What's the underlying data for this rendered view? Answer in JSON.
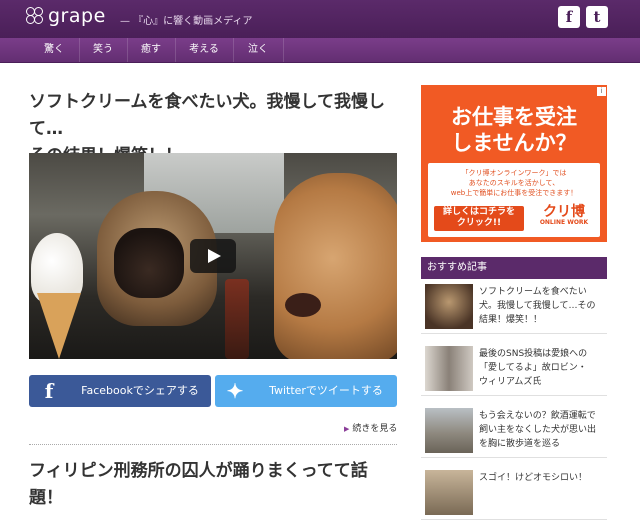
{
  "header": {
    "logo_text": "grape",
    "tagline": "— 『心』に響く動画メディア",
    "social": [
      {
        "label": "f",
        "icon": "facebook-icon",
        "color": "#3b5998"
      },
      {
        "label": "t",
        "icon": "twitter-icon",
        "color": "#55acee"
      }
    ]
  },
  "nav": {
    "items": [
      "驚く",
      "笑う",
      "癒す",
      "考える",
      "泣く"
    ]
  },
  "article1": {
    "title_line1": "ソフトクリームを食べたい犬。我慢して我慢して…",
    "title_line2": "その結果！爆笑！！",
    "share_facebook": "Facebookでシェアする",
    "share_twitter": "Twitterでツイートする",
    "more_link": "続きを見る"
  },
  "article2": {
    "title": "フィリピン刑務所の囚人が踊りまくってて話題！"
  },
  "ad": {
    "close_label": "i",
    "headline_line1": "お仕事を受注",
    "headline_line2": "しませんか？",
    "body_line1": "「クリ博オンラインワーク」では",
    "body_line2": "あなたのスキルを活かして、",
    "body_line3": "web上で簡単にお仕事を受注できます！",
    "button_line1": "詳しくはコチラを",
    "button_line2": "クリック!!",
    "logo_text": "クリ博",
    "logo_sub": "ONLINE WORK"
  },
  "sidebar": {
    "heading": "おすすめ記事",
    "items": [
      {
        "line1": "ソフトクリームを食べたい",
        "line2": "犬。我慢して我慢して…その",
        "line3": "結果！爆笑！！"
      },
      {
        "line1": "最後のSNS投稿は愛娘への",
        "line2": "「愛してるよ」故ロビン・",
        "line3": "ウィリアムズ氏"
      },
      {
        "line1": "もう会えないの？飲酒運転で",
        "line2": "飼い主をなくした犬が思い出",
        "line3": "を胸に散歩道を巡る"
      },
      {
        "line1": "スゴイ！けどオモシロい！",
        "line2": "",
        "line3": ""
      }
    ]
  },
  "colors": {
    "header": "#4a1f58",
    "nav": "#6e3580",
    "facebook": "#3b5998",
    "twitter": "#55acee",
    "ad": "#f15a24"
  }
}
